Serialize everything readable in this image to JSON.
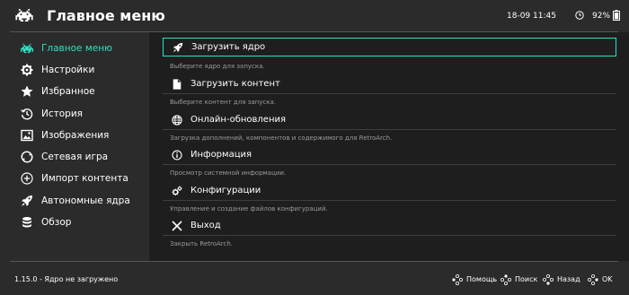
{
  "header": {
    "title": "Главное меню",
    "time": "18-09 11:45",
    "battery": "92%",
    "logo_icon": "space-invader-icon",
    "clock_icon": "clock-icon",
    "battery_icon": "battery-icon"
  },
  "sidebar": {
    "accent_color": "#2ee0c1",
    "items": [
      {
        "label": "Главное меню",
        "icon": "invader-icon",
        "active": true
      },
      {
        "label": "Настройки",
        "icon": "gear-icon"
      },
      {
        "label": "Избранное",
        "icon": "star-icon"
      },
      {
        "label": "История",
        "icon": "history-icon"
      },
      {
        "label": "Изображения",
        "icon": "image-icon"
      },
      {
        "label": "Сетевая игра",
        "icon": "netplay-icon"
      },
      {
        "label": "Импорт контента",
        "icon": "plus-circle-icon"
      },
      {
        "label": "Автономные ядра",
        "icon": "rocket-icon"
      },
      {
        "label": "Обзор",
        "icon": "database-icon"
      }
    ]
  },
  "main": {
    "entries": [
      {
        "label": "Загрузить ядро",
        "desc": "Выберите ядро для запуска.",
        "icon": "rocket-icon",
        "selected": true
      },
      {
        "label": "Загрузить контент",
        "desc": "Выберите контент для запуска.",
        "icon": "file-icon"
      },
      {
        "label": "Онлайн-обновления",
        "desc": "Загрузка дополнений, компонентов и содержимого для RetroArch.",
        "icon": "globe-icon"
      },
      {
        "label": "Информация",
        "desc": "Просмотр системной информации.",
        "icon": "info-icon"
      },
      {
        "label": "Конфигурации",
        "desc": "Управление и создание файлов конфигураций.",
        "icon": "gears-icon"
      },
      {
        "label": "Выход",
        "desc": "Закрыть RetroArch.",
        "icon": "close-icon"
      }
    ]
  },
  "footer": {
    "version": "1.15.0 - Ядро не загружено",
    "hints": [
      {
        "label": "Помощь",
        "icon": "gamepad-button-icon"
      },
      {
        "label": "Поиск",
        "icon": "gamepad-button-icon"
      },
      {
        "label": "Назад",
        "icon": "gamepad-button-icon"
      },
      {
        "label": "OK",
        "icon": "gamepad-button-icon"
      }
    ]
  }
}
